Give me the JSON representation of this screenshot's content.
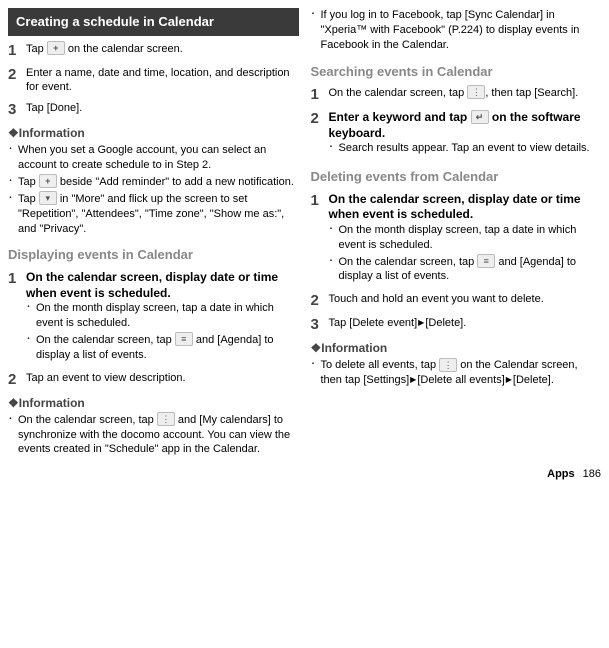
{
  "left": {
    "header": "Creating a schedule in Calendar",
    "steps_create": [
      {
        "num": "1",
        "text_a": "Tap ",
        "text_b": " on the calendar screen."
      },
      {
        "num": "2",
        "text": "Enter a name, date and time, location, and description for event."
      },
      {
        "num": "3",
        "text": "Tap [Done]."
      }
    ],
    "info_label": "❖Information",
    "info_create": [
      "When you set a Google account, you can select an account to create schedule to in Step 2.",
      "Tap ICON beside \"Add reminder\" to add a new notification.",
      "Tap ICON in \"More\" and flick up the screen to set \"Repetition\", \"Attendees\", \"Time zone\", \"Show me as:\", and \"Privacy\"."
    ],
    "title_display": "Displaying events in Calendar",
    "steps_display": [
      {
        "num": "1",
        "bold": "On the calendar screen, display date or time when event is scheduled.",
        "subs": [
          "On the month display screen, tap a date in which event is scheduled.",
          "On the calendar screen, tap ICON and [Agenda] to display a list of events."
        ]
      },
      {
        "num": "2",
        "bold": "Tap an event to view description."
      }
    ],
    "info_display": [
      "On the calendar screen, tap ICON and [My calendars] to synchronize with the docomo account. You can view the events created in \"Schedule\" app in the Calendar."
    ]
  },
  "right": {
    "top_bullet": "If you log in to Facebook, tap [Sync Calendar] in \"Xperia™ with Facebook\" (P.224) to display events in Facebook in the Calendar.",
    "title_search": "Searching events in Calendar",
    "steps_search": [
      {
        "num": "1",
        "text_a": "On the calendar screen, tap ",
        "text_b": ", then tap [Search]."
      },
      {
        "num": "2",
        "text_a": "Enter a keyword and tap ",
        "text_b": " on the software keyboard.",
        "sub": "Search results appear. Tap an event to view details."
      }
    ],
    "title_delete": "Deleting events from Calendar",
    "steps_delete": [
      {
        "num": "1",
        "bold": "On the calendar screen, display date or time when event is scheduled.",
        "subs": [
          "On the month display screen, tap a date in which event is scheduled.",
          "On the calendar screen, tap ICON and [Agenda] to display a list of events."
        ]
      },
      {
        "num": "2",
        "bold": "Touch and hold an event you want to delete."
      },
      {
        "num": "3",
        "text": "Tap [Delete event]ARROW[Delete]."
      }
    ],
    "info_label": "❖Information",
    "info_delete": "To delete all events, tap ICON on the Calendar screen, then tap [Settings]ARROW[Delete all events]ARROW[Delete].",
    "footer_apps": "Apps",
    "footer_page": "186"
  }
}
